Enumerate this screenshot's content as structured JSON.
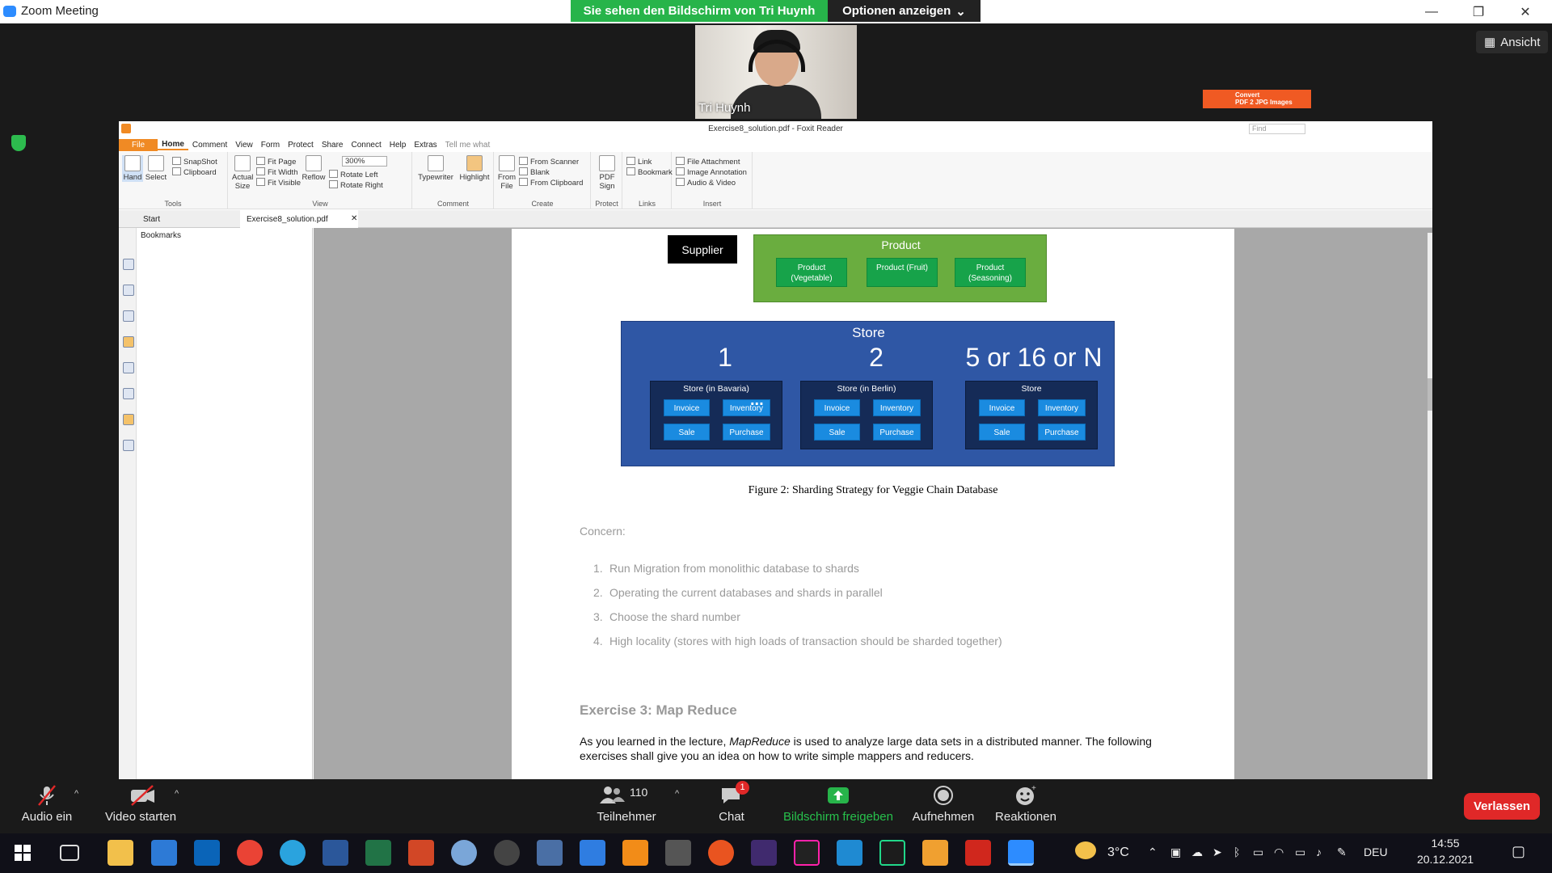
{
  "window": {
    "title": "Zoom Meeting",
    "minimize": "—",
    "restore": "❐",
    "close": "✕"
  },
  "banner": {
    "text": "Sie sehen den Bildschirm von Tri Huynh",
    "options": "Optionen anzeigen"
  },
  "view_button": "Ansicht",
  "participant": {
    "name": "Tri Huynh"
  },
  "foxit": {
    "title": "Exercise8_solution.pdf - Foxit Reader",
    "find_placeholder": "Find",
    "menu": [
      "File",
      "Home",
      "Comment",
      "View",
      "Form",
      "Protect",
      "Share",
      "Connect",
      "Help",
      "Extras",
      "Tell me what"
    ],
    "tools": {
      "hand": "Hand",
      "select": "Select",
      "snapshot": "SnapShot",
      "clipboard": "Clipboard",
      "label": "Tools"
    },
    "view": {
      "actual_size": "Actual Size",
      "fit_page": "Fit Page",
      "fit_width": "Fit Width",
      "fit_visible": "Fit Visible",
      "reflow": "Reflow",
      "zoom": "300%",
      "rotate_left": "Rotate Left",
      "rotate_right": "Rotate Right",
      "label": "View"
    },
    "comment": {
      "typewriter": "Typewriter",
      "highlight": "Highlight",
      "label": "Comment"
    },
    "create": {
      "from_file": "From File",
      "from_scanner": "From Scanner",
      "blank": "Blank",
      "from_clipboard": "From Clipboard",
      "label": "Create"
    },
    "protect": {
      "pdf_sign": "PDF Sign",
      "label": "Protect"
    },
    "links": {
      "link": "Link",
      "bookmark": "Bookmark",
      "label": "Links"
    },
    "insert": {
      "file_attachment": "File Attachment",
      "image_annotation": "Image Annotation",
      "audio_video": "Audio & Video",
      "label": "Insert"
    },
    "tabs": {
      "start": "Start",
      "doc": "Exercise8_solution.pdf",
      "close": "✕"
    },
    "convert": {
      "line1": "Convert",
      "line2": "PDF 2 JPG Images"
    },
    "bookmarks": "Bookmarks"
  },
  "document": {
    "supplier": "Supplier",
    "product": {
      "title": "Product",
      "items": [
        "Product (Vegetable)",
        "Product (Fruit)",
        "Product (Seasoning)"
      ]
    },
    "store": {
      "title": "Store",
      "nums": [
        "1",
        "2",
        "5 or 16 or N"
      ],
      "shards": [
        {
          "name": "Store (in Bavaria)",
          "chips": [
            "Invoice",
            "Inventory",
            "Sale",
            "Purchase"
          ]
        },
        {
          "name": "Store (in Berlin)",
          "chips": [
            "Invoice",
            "Inventory",
            "Sale",
            "Purchase"
          ]
        },
        {
          "name": "Store",
          "chips": [
            "Invoice",
            "Inventory",
            "Sale",
            "Purchase"
          ]
        }
      ],
      "dots": "..."
    },
    "caption": "Figure 2: Sharding Strategy for Veggie Chain Database",
    "concern": "Concern:",
    "list": [
      {
        "n": "1.",
        "t": "Run Migration from monolithic database to shards"
      },
      {
        "n": "2.",
        "t": "Operating the current databases and shards in parallel"
      },
      {
        "n": "3.",
        "t": "Choose the shard number"
      },
      {
        "n": "4.",
        "t": "High locality (stores with high loads of transaction should be sharded together)"
      }
    ],
    "exercise_title": "Exercise 3: Map Reduce",
    "paragraph_pre": "As you learned in the lecture, ",
    "paragraph_em": "MapReduce",
    "paragraph_post": " is used to analyze large data sets in a distributed manner.  The following exercises shall give you an idea on how to write simple mappers and reducers."
  },
  "controls": {
    "audio": "Audio ein",
    "video": "Video starten",
    "participants": "Teilnehmer",
    "participant_count": "110",
    "chat": "Chat",
    "chat_badge": "1",
    "share": "Bildschirm freigeben",
    "record": "Aufnehmen",
    "reactions": "Reaktionen",
    "leave": "Verlassen"
  },
  "taskbar": {
    "weather": "3°C",
    "lang": "DEU",
    "time": "14:55",
    "date": "20.12.2021"
  },
  "colors": {
    "share_green": "#27b44a",
    "leave_red": "#e02828",
    "foxit_orange": "#f08a24",
    "store_blue": "#2f57a5",
    "product_green": "#6aad3f"
  }
}
